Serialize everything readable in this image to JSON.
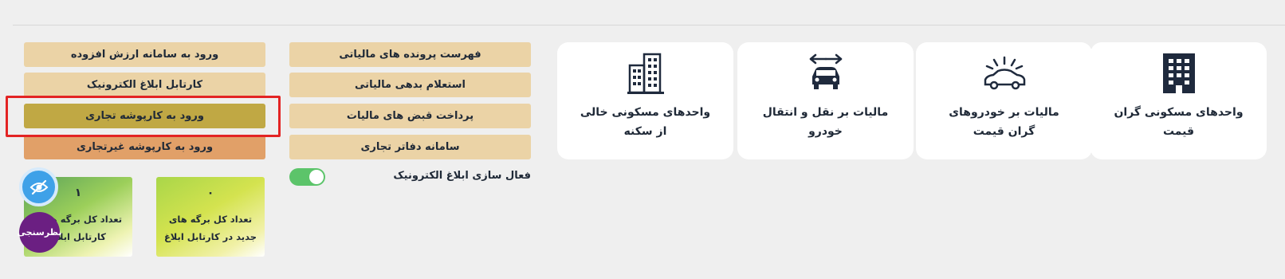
{
  "cards": [
    {
      "label": "واحدهای مسکونی گران قیمت",
      "icon": "building-icon"
    },
    {
      "label": "مالیات بر خودروهای گران قیمت",
      "icon": "luxury-car-icon"
    },
    {
      "label": "مالیات بر نقل و انتقال خودرو",
      "icon": "car-transfer-icon"
    },
    {
      "label": "واحدهای مسکونی خالی از سکنه",
      "icon": "apartment-buildings-icon"
    }
  ],
  "middle_buttons": [
    "فهرست پرونده های مالیاتی",
    "استعلام بدهی مالیاتی",
    "پرداخت قبض های مالیات",
    "سامانه دفاتر تجاری"
  ],
  "left_buttons": [
    "ورود به سامانه ارزش افزوده",
    "کارتابل ابلاغ الکترونیک",
    "ورود به کارپوشه تجاری",
    "ورود به کارپوشه غیرتجاری"
  ],
  "toggle": {
    "label": "فعال سازی ابلاغ الکترونیک",
    "on": true
  },
  "tiles": [
    {
      "count": "۰",
      "text": "تعداد کل برگه های جدید در کارتابل ابلاغ"
    },
    {
      "count": "۱",
      "text": "تعداد کل برگه ها در کارتابل ابلاغ"
    }
  ],
  "floating": {
    "survey_label": "نظرسنجی",
    "eye_icon": "eye-slash-icon"
  },
  "colors": {
    "button": "#ebd3a6",
    "active": "#c0a844",
    "orange": "#e1a068",
    "highlight": "#e32424",
    "toggle_on": "#5cc46a"
  }
}
